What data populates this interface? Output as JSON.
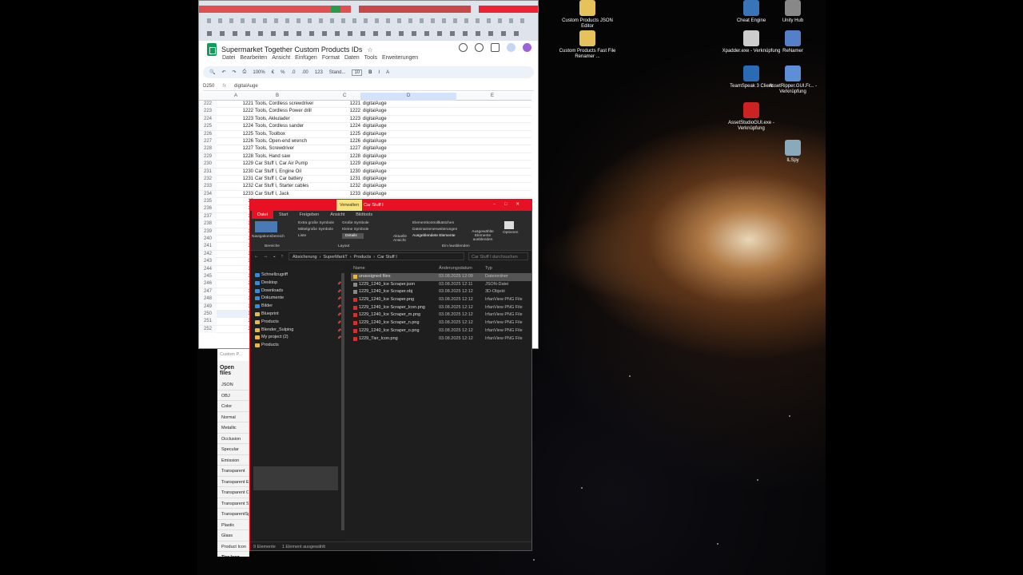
{
  "desktop": {
    "icons": [
      {
        "label": "Custom Products JSON Editor",
        "icon": "json-editor-icon"
      },
      {
        "label": "Custom Products Fast File Renamer ...",
        "icon": "file-renamer-icon"
      },
      {
        "label": "Cheat Engine",
        "icon": "cheat-engine-icon"
      },
      {
        "label": "Unity Hub",
        "icon": "unity-hub-icon"
      },
      {
        "label": "Xpadder.exe - Verknüpfung",
        "icon": "gamepad-icon"
      },
      {
        "label": "ReNamer",
        "icon": "renamer-icon"
      },
      {
        "label": "TeamSpeak 3 Client",
        "icon": "teamspeak-icon"
      },
      {
        "label": "AssetRipper.GUI.Fr... - Verknüpfung",
        "icon": "assetripper-icon"
      },
      {
        "label": "AssetStudioGUI.exe - Verknüpfung",
        "icon": "assetstudio-icon"
      },
      {
        "label": "ILSpy",
        "icon": "ilspy-icon"
      }
    ]
  },
  "sheets": {
    "title": "Supermarket Together Custom Products IDs",
    "menu": [
      "Datei",
      "Bearbeiten",
      "Ansicht",
      "Einfügen",
      "Format",
      "Daten",
      "Tools",
      "Erweiterungen"
    ],
    "toolbar": {
      "zoom": "100%",
      "currency": "€",
      "percent": "%",
      "dec1": ".0",
      "dec2": ".00",
      "num": "123",
      "font": "Stand...",
      "size": "10",
      "bold": "B",
      "italic": "I"
    },
    "cell_ref": "D250",
    "fx_label": "fx",
    "formula": "digitalAuge",
    "columns": [
      "A",
      "B",
      "C",
      "D",
      "E"
    ],
    "rows": [
      {
        "n": "222",
        "a": "1221",
        "b": "Tools, Cordless screwdriver",
        "c": "1221",
        "d": "digitalAuge"
      },
      {
        "n": "223",
        "a": "1222",
        "b": "Tools, Cordless Power drill",
        "c": "1222",
        "d": "digitalAuge"
      },
      {
        "n": "224",
        "a": "1223",
        "b": "Tools, Akkulader",
        "c": "1223",
        "d": "digitalAuge"
      },
      {
        "n": "225",
        "a": "1224",
        "b": "Tools, Cordless sander",
        "c": "1224",
        "d": "digitalAuge"
      },
      {
        "n": "226",
        "a": "1225",
        "b": "Tools, Toolbox",
        "c": "1225",
        "d": "digitalAuge"
      },
      {
        "n": "227",
        "a": "1226",
        "b": "Tools, Open-end wrench",
        "c": "1226",
        "d": "digitalAuge"
      },
      {
        "n": "228",
        "a": "1227",
        "b": "Tools, Screwdriver",
        "c": "1227",
        "d": "digitalAuge"
      },
      {
        "n": "229",
        "a": "1228",
        "b": "Tools, Hand saw",
        "c": "1228",
        "d": "digitalAuge"
      },
      {
        "n": "230",
        "a": "1229",
        "b": "Car Stuff I, Car Air Pump",
        "c": "1229",
        "d": "digitalAuge"
      },
      {
        "n": "231",
        "a": "1230",
        "b": "Car Stuff I, Engine Oil",
        "c": "1230",
        "d": "digitalAuge"
      },
      {
        "n": "232",
        "a": "1231",
        "b": "Car Stuff I, Car battery",
        "c": "1231",
        "d": "digitalAuge"
      },
      {
        "n": "233",
        "a": "1232",
        "b": "Car Stuff I, Starter cables",
        "c": "1232",
        "d": "digitalAuge"
      },
      {
        "n": "234",
        "a": "1233",
        "b": "Car Stuff I, Jack",
        "c": "1233",
        "d": "digitalAuge"
      },
      {
        "n": "235",
        "a": "12",
        "b": "",
        "c": "",
        "d": ""
      },
      {
        "n": "236",
        "a": "12",
        "b": "",
        "c": "",
        "d": ""
      },
      {
        "n": "237",
        "a": "12",
        "b": "",
        "c": "",
        "d": ""
      },
      {
        "n": "238",
        "a": "12",
        "b": "",
        "c": "",
        "d": ""
      },
      {
        "n": "239",
        "a": "12",
        "b": "",
        "c": "",
        "d": ""
      },
      {
        "n": "240",
        "a": "12",
        "b": "",
        "c": "",
        "d": ""
      },
      {
        "n": "241",
        "a": "12",
        "b": "",
        "c": "",
        "d": ""
      },
      {
        "n": "242",
        "a": "12",
        "b": "",
        "c": "",
        "d": ""
      },
      {
        "n": "243",
        "a": "12",
        "b": "",
        "c": "",
        "d": ""
      },
      {
        "n": "244",
        "a": "12",
        "b": "",
        "c": "",
        "d": ""
      },
      {
        "n": "245",
        "a": "12",
        "b": "",
        "c": "",
        "d": ""
      },
      {
        "n": "246",
        "a": "12",
        "b": "",
        "c": "",
        "d": ""
      },
      {
        "n": "247",
        "a": "12",
        "b": "",
        "c": "",
        "d": ""
      },
      {
        "n": "248",
        "a": "12",
        "b": "",
        "c": "",
        "d": ""
      },
      {
        "n": "249",
        "a": "12",
        "b": "",
        "c": "",
        "d": ""
      },
      {
        "n": "250",
        "a": "12",
        "b": "",
        "c": "",
        "d": ""
      },
      {
        "n": "251",
        "a": "12",
        "b": "",
        "c": "",
        "d": ""
      },
      {
        "n": "252",
        "a": "12",
        "b": "",
        "c": "",
        "d": ""
      }
    ]
  },
  "sidepanel": {
    "header": "Custom P...",
    "title": "Open files",
    "items": [
      "JSON",
      "OBJ",
      "Color",
      "Normal",
      "Metallic",
      "Occlusion",
      "Specular",
      "Emission",
      "Transparent",
      "Transparent Em",
      "Transparent C",
      "Transparent S",
      "TransparentSp",
      "Plastic",
      "Glass",
      "Product Icon",
      "Tier Icon"
    ]
  },
  "explorer": {
    "context_tab": "Verwalten",
    "title": "Car Stuff I",
    "tabs": [
      "Datei",
      "Start",
      "Freigeben",
      "Ansicht",
      "Bildtools"
    ],
    "ribbon": {
      "nav_pane": "Navigationsbereich",
      "panes": "Bereiche",
      "layout_opts": [
        "Extra große Symbole",
        "Große Symbole",
        "Mittelgroße Symbole",
        "Kleine Symbole",
        "Liste",
        "Details"
      ],
      "layout": "Layout",
      "current_view": "Aktuelle Ansicht",
      "show_hide": [
        "Elementkontrollkästchen",
        "Dateinamenerweiterungen",
        "Ausgeblendete Elemente"
      ],
      "hide_selected": "Ausgewählte Elemente ausblenden",
      "options": "Optionen",
      "group": "Ein-/ausblenden"
    },
    "address": [
      "Absicherung",
      "SuperMarkT",
      "Products",
      "Car Stuff I"
    ],
    "search_placeholder": "Car Stuff I durchsuchen",
    "nav": [
      {
        "label": "Schnellzugriff",
        "type": "blue",
        "pin": false
      },
      {
        "label": "Desktop",
        "type": "blue",
        "pin": true
      },
      {
        "label": "Downloads",
        "type": "blue",
        "pin": true
      },
      {
        "label": "Dokumente",
        "type": "blue",
        "pin": true
      },
      {
        "label": "Bilder",
        "type": "blue",
        "pin": true
      },
      {
        "label": "Blueprint",
        "type": "folder",
        "pin": true
      },
      {
        "label": "Products",
        "type": "folder",
        "pin": true
      },
      {
        "label": "Blender_Sulping",
        "type": "folder",
        "pin": true
      },
      {
        "label": "My project (2)",
        "type": "folder",
        "pin": true
      },
      {
        "label": "Products",
        "type": "folder",
        "pin": false
      }
    ],
    "columns": [
      "Name",
      "Änderungsdatum",
      "Typ"
    ],
    "files": [
      {
        "name": "unassigned files",
        "date": "03.08.2025 12:09",
        "type": "Dateiordner",
        "kind": "folder"
      },
      {
        "name": "1229_1240_Ice Scraper.json",
        "date": "03.08.2025 12:11",
        "type": "JSON-Datei",
        "kind": "js"
      },
      {
        "name": "1229_1240_Ice Scraper.obj",
        "date": "03.08.2025 12:12",
        "type": "3D-Objekt",
        "kind": "js"
      },
      {
        "name": "1229_1240_Ice Scraper.png",
        "date": "03.08.2025 12:12",
        "type": "IrfanView PNG File",
        "kind": "img"
      },
      {
        "name": "1229_1240_Ice Scraper_Icon.png",
        "date": "03.08.2025 12:12",
        "type": "IrfanView PNG File",
        "kind": "img"
      },
      {
        "name": "1229_1240_Ice Scraper_m.png",
        "date": "03.08.2025 12:12",
        "type": "IrfanView PNG File",
        "kind": "img"
      },
      {
        "name": "1229_1240_Ice Scraper_n.png",
        "date": "03.08.2025 12:12",
        "type": "IrfanView PNG File",
        "kind": "img"
      },
      {
        "name": "1229_1240_Ice Scraper_o.png",
        "date": "03.08.2025 12:12",
        "type": "IrfanView PNG File",
        "kind": "img"
      },
      {
        "name": "1229_Tier_Icon.png",
        "date": "03.08.2025 12:12",
        "type": "IrfanView PNG File",
        "kind": "img"
      }
    ],
    "status": {
      "count": "9 Elemente",
      "selected": "1 Element ausgewählt"
    }
  }
}
